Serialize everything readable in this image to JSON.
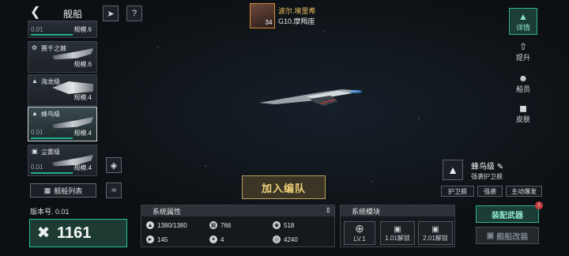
{
  "header": {
    "title": "舰船",
    "back_icon": "back-chevron-icon"
  },
  "commander": {
    "name": "波尔.埃里希",
    "level": "34",
    "location": "G10.摩羯座"
  },
  "ship_list": [
    {
      "name": "",
      "class_icon": "none",
      "power": "0.01",
      "scale": "规模.6",
      "selected": false,
      "top": "partial"
    },
    {
      "name": "赛千之棘",
      "power": "0.01",
      "scale": "规模.6",
      "selected": false
    },
    {
      "name": "海龙级",
      "power": "0.01",
      "scale": "规模.4",
      "selected": false
    },
    {
      "name": "蜂鸟级",
      "power": "0.01",
      "scale": "规模.4",
      "selected": true
    },
    {
      "name": "尘雾级",
      "power": "0.01",
      "scale": "规模.4",
      "selected": false
    }
  ],
  "list_button": "舰船列表",
  "version_label": "版本号. 0.01",
  "power_value": "1161",
  "join_fleet_label": "加入编队",
  "right_tabs": [
    {
      "label": "详情",
      "icon": "details-icon",
      "active": true
    },
    {
      "label": "提升",
      "icon": "upgrade-icon",
      "active": false
    },
    {
      "label": "船员",
      "icon": "crew-icon",
      "active": false
    },
    {
      "label": "皮肤",
      "icon": "skin-icon",
      "active": false
    }
  ],
  "ship_class": {
    "name": "蜂鸟级",
    "role": "强袭护卫舰",
    "tags": [
      "护卫舰",
      "强袭",
      "主动爆发"
    ]
  },
  "attributes": {
    "header": "系统属性",
    "items": [
      {
        "icon": "hull-icon",
        "value": "1380/1380"
      },
      {
        "icon": "armor-icon",
        "value": "766"
      },
      {
        "icon": "energy-icon",
        "value": "518"
      },
      {
        "icon": "speed-icon",
        "value": "145"
      },
      {
        "icon": "weapon-slots-icon",
        "value": "4"
      },
      {
        "icon": "range-icon",
        "value": "4240"
      }
    ]
  },
  "modules": {
    "header": "系统模块",
    "slots": [
      {
        "label": "LV.1",
        "locked": false
      },
      {
        "label": "1.01解锁",
        "locked": true
      },
      {
        "label": "2.01解锁",
        "locked": true
      }
    ]
  },
  "equip_weapons_label": "装配武器",
  "equip_badge": "1",
  "refit_label": "舰船改装"
}
